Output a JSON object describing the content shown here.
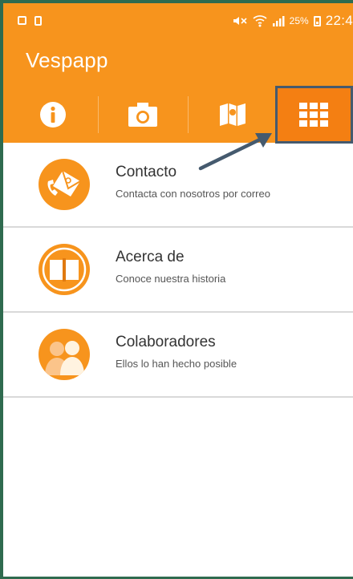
{
  "status_bar": {
    "battery_percent": "25%",
    "time": "22:4"
  },
  "app": {
    "title": "Vespapp"
  },
  "tabs": [
    {
      "icon": "info-icon",
      "active": false
    },
    {
      "icon": "camera-icon",
      "active": false
    },
    {
      "icon": "map-icon",
      "active": false
    },
    {
      "icon": "grid-icon",
      "active": true
    }
  ],
  "menu": {
    "items": [
      {
        "title": "Contacto",
        "subtitle": "Contacta con nosotros por correo",
        "icon": "contact-mail-icon"
      },
      {
        "title": "Acerca de",
        "subtitle": "Conoce nuestra historia",
        "icon": "book-icon"
      },
      {
        "title": "Colaboradores",
        "subtitle": "Ellos lo han hecho posible",
        "icon": "people-icon"
      }
    ]
  },
  "colors": {
    "accent": "#f7941d",
    "highlight_border": "#455a6e",
    "divider": "#d9d9d9"
  }
}
